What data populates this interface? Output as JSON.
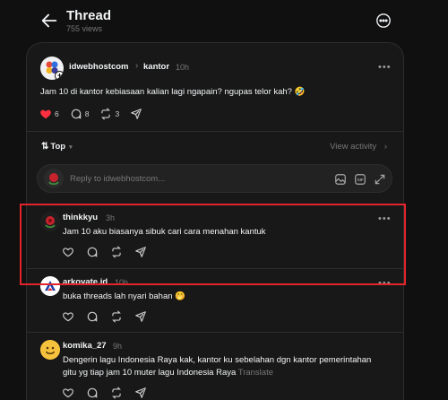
{
  "header": {
    "title": "Thread",
    "views": "755 views"
  },
  "post": {
    "author": "idwebhostcom",
    "separator": "›",
    "topic": "kantor",
    "time": "10h",
    "text": "Jam 10 di kantor kebiasaan kalian lagi ngapain? ngupas telor kah? 🤣",
    "likes": "6",
    "comments": "8",
    "reposts": "3",
    "liked": true,
    "like_color": "#ff3040"
  },
  "sort": {
    "label": "Top",
    "view_activity": "View activity",
    "chevron": "›"
  },
  "reply": {
    "placeholder": "Reply to idwebhostcom..."
  },
  "comments": [
    {
      "author": "thinkkyu",
      "time": "3h",
      "text": "Jam 10 aku biasanya sibuk cari cara menahan kantuk",
      "avatar": "rose-avatar"
    },
    {
      "author": "arkovate.id",
      "time": "10h",
      "text": "buka threads lah nyari bahan 🤭",
      "avatar": "arkovate-logo-avatar"
    },
    {
      "author": "komika_27",
      "time": "9h",
      "text_line1": "Dengerin lagu Indonesia Raya kak, kantor ku sebelahan dgn kantor pemerintahan",
      "text_line2": "gitu yg tiap jam 10 muter lagu Indonesia Raya",
      "translate": "Translate",
      "avatar": "smiley-avatar"
    }
  ],
  "colors": {
    "background": "#101010",
    "card": "#181818",
    "highlight": "#e3242b",
    "muted": "#777777"
  }
}
